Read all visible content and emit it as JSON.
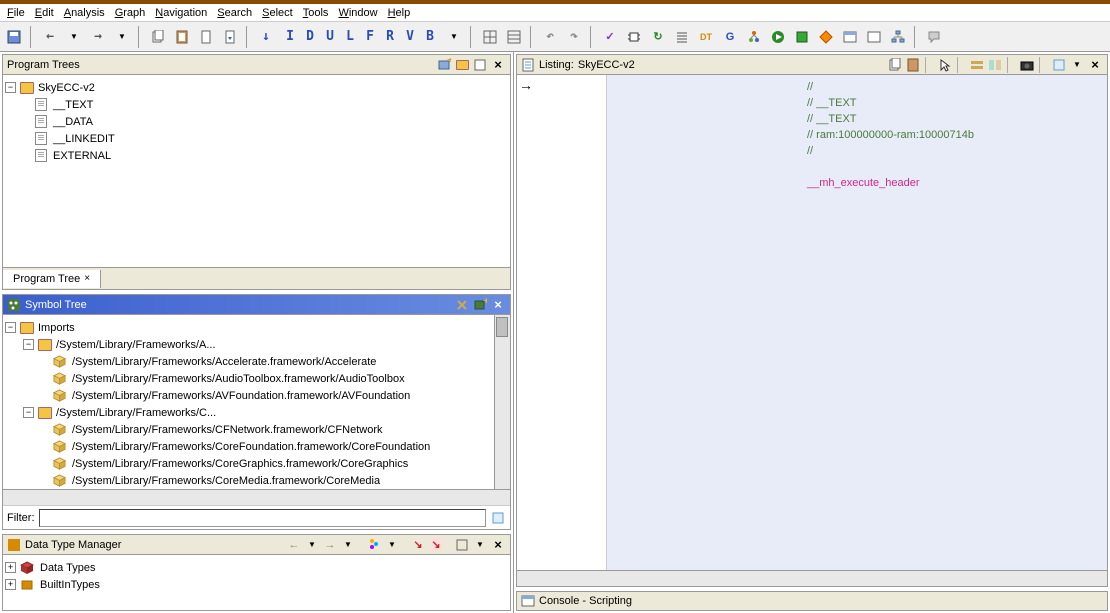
{
  "menubar": [
    "File",
    "Edit",
    "Analysis",
    "Graph",
    "Navigation",
    "Search",
    "Select",
    "Tools",
    "Window",
    "Help"
  ],
  "toolbar_letters": [
    "I",
    "D",
    "U",
    "L",
    "F",
    "R",
    "V",
    "B"
  ],
  "program_trees": {
    "title": "Program Trees",
    "root": "SkyECC-v2",
    "items": [
      "__TEXT",
      "__DATA",
      "__LINKEDIT",
      "EXTERNAL"
    ],
    "tab": "Program Tree"
  },
  "symbol_tree": {
    "title": "Symbol Tree",
    "root": "Imports",
    "folders": [
      {
        "name": "/System/Library/Frameworks/A...",
        "children": [
          "/System/Library/Frameworks/Accelerate.framework/Accelerate",
          "/System/Library/Frameworks/AudioToolbox.framework/AudioToolbox",
          "/System/Library/Frameworks/AVFoundation.framework/AVFoundation"
        ]
      },
      {
        "name": "/System/Library/Frameworks/C...",
        "children": [
          "/System/Library/Frameworks/CFNetwork.framework/CFNetwork",
          "/System/Library/Frameworks/CoreFoundation.framework/CoreFoundation",
          "/System/Library/Frameworks/CoreGraphics.framework/CoreGraphics",
          "/System/Library/Frameworks/CoreMedia.framework/CoreMedia"
        ]
      }
    ],
    "filter_label": "Filter:"
  },
  "data_type_manager": {
    "title": "Data Type Manager",
    "items": [
      "Data Types",
      "BuiltInTypes"
    ]
  },
  "listing": {
    "title": "Listing:",
    "name": "SkyECC-v2",
    "lines": [
      {
        "t": "//",
        "c": "comment"
      },
      {
        "t": "//  __TEXT",
        "c": "comment"
      },
      {
        "t": "//  __TEXT",
        "c": "comment"
      },
      {
        "t": "//  ram:100000000-ram:10000714b",
        "c": "comment"
      },
      {
        "t": "//",
        "c": "comment"
      },
      {
        "t": "",
        "c": ""
      },
      {
        "t": "__mh_execute_header",
        "c": "label"
      }
    ]
  },
  "console": {
    "title": "Console - Scripting"
  }
}
